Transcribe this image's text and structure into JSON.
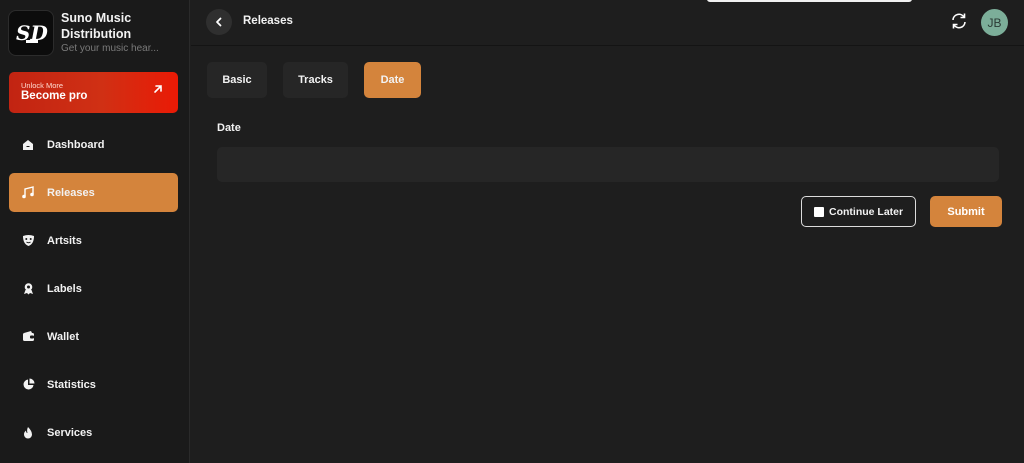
{
  "brand": {
    "title": "Suno Music Distribution",
    "subtitle": "Get your music hear...",
    "logo_text": "SD"
  },
  "promo": {
    "small": "Unlock More",
    "big": "Become pro",
    "icon": "arrow-up-right-icon"
  },
  "sidebar": {
    "items": [
      {
        "label": "Dashboard",
        "icon": "home-icon",
        "active": false
      },
      {
        "label": "Releases",
        "icon": "music-notes-icon",
        "active": true
      },
      {
        "label": "Artsits",
        "icon": "mask-icon",
        "active": false
      },
      {
        "label": "Labels",
        "icon": "label-badge-icon",
        "active": false
      },
      {
        "label": "Wallet",
        "icon": "wallet-icon",
        "active": false
      },
      {
        "label": "Statistics",
        "icon": "pie-chart-icon",
        "active": false
      },
      {
        "label": "Services",
        "icon": "flame-icon",
        "active": false
      }
    ]
  },
  "header": {
    "title": "Releases",
    "back_icon": "chevron-left-icon",
    "refresh_icon": "refresh-icon",
    "avatar_initials": "JB"
  },
  "tabs": [
    {
      "label": "Basic",
      "active": false
    },
    {
      "label": "Tracks",
      "active": false
    },
    {
      "label": "Date",
      "active": true
    }
  ],
  "form": {
    "date_label": "Date",
    "date_value": "",
    "date_placeholder": "",
    "continue_label": "Continue Later",
    "submit_label": "Submit"
  },
  "colors": {
    "accent": "#d4843c",
    "promo_red": "#d03014",
    "avatar": "#7cae99",
    "background": "#1e1e1e",
    "sidebar": "#1a1a1a"
  }
}
